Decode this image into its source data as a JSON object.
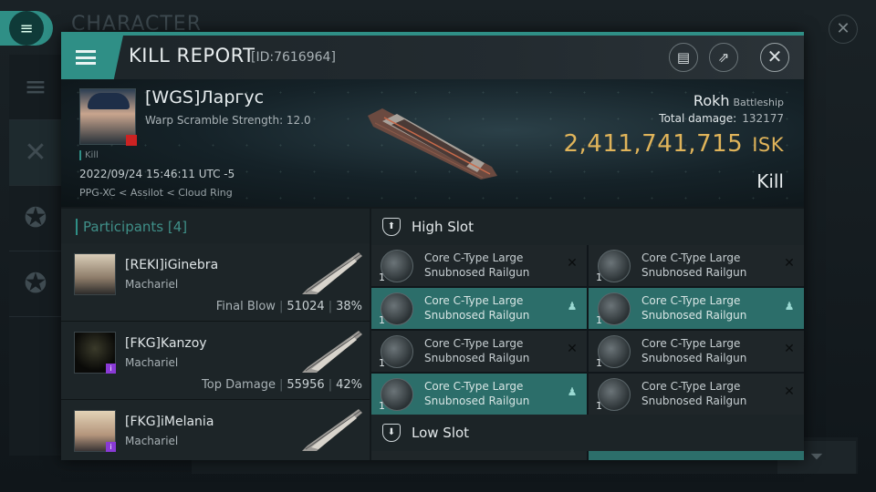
{
  "background": {
    "title": "CHARACTER",
    "menu_icon": "menu-icon",
    "close_icon": "close-icon"
  },
  "window": {
    "title": "KILL REPORT",
    "id_label": "[ID:7616964]",
    "accent": "#2f8f86",
    "buttons": [
      {
        "icon": "clipboard-icon",
        "glyph": "▤"
      },
      {
        "icon": "share-icon",
        "glyph": "⇗"
      },
      {
        "icon": "close-icon",
        "glyph": "✕"
      }
    ]
  },
  "victim": {
    "name": "[WGS]Ларгус",
    "warp_scramble": "Warp Scramble Strength: 12.0",
    "tag": "Kill",
    "datetime": "2022/09/24 15:46:11 UTC -5",
    "location": "PPG-XC < Assilot < Cloud Ring",
    "ship": "Rokh",
    "ship_class": "Battleship",
    "total_damage_label": "Total damage:",
    "total_damage": "132177",
    "isk_value": "2,411,741,715",
    "isk_unit": "ISK",
    "result": "Kill"
  },
  "participants": {
    "header": "Participants [4]",
    "rows": [
      {
        "name": "[REKI]iGinebra",
        "ship": "Machariel",
        "stat_label": "Final Blow",
        "damage": "51024",
        "percent": "38%"
      },
      {
        "name": "[FKG]Kanzoy",
        "ship": "Machariel",
        "stat_label": "Top Damage",
        "damage": "55956",
        "percent": "42%"
      },
      {
        "name": "[FKG]iMelania",
        "ship": "Machariel",
        "stat_label": "",
        "damage": "",
        "percent": ""
      }
    ]
  },
  "slots": {
    "high_label": "High Slot",
    "low_label": "Low Slot",
    "high": [
      {
        "qty": "1",
        "name": "Core C-Type Large Snubnosed Railgun",
        "status": "destroyed",
        "glyph": "✕"
      },
      {
        "qty": "1",
        "name": "Core C-Type Large Snubnosed Railgun",
        "status": "destroyed",
        "glyph": "✕"
      },
      {
        "qty": "1",
        "name": "Core C-Type Large Snubnosed Railgun",
        "status": "dropped",
        "glyph": "♟"
      },
      {
        "qty": "1",
        "name": "Core C-Type Large Snubnosed Railgun",
        "status": "dropped",
        "glyph": "♟"
      },
      {
        "qty": "1",
        "name": "Core C-Type Large Snubnosed Railgun",
        "status": "destroyed",
        "glyph": "✕"
      },
      {
        "qty": "1",
        "name": "Core C-Type Large Snubnosed Railgun",
        "status": "destroyed",
        "glyph": "✕"
      },
      {
        "qty": "1",
        "name": "Core C-Type Large Snubnosed Railgun",
        "status": "dropped",
        "glyph": "♟"
      },
      {
        "qty": "1",
        "name": "Core C-Type Large Snubnosed Railgun",
        "status": "destroyed",
        "glyph": "✕"
      }
    ]
  }
}
